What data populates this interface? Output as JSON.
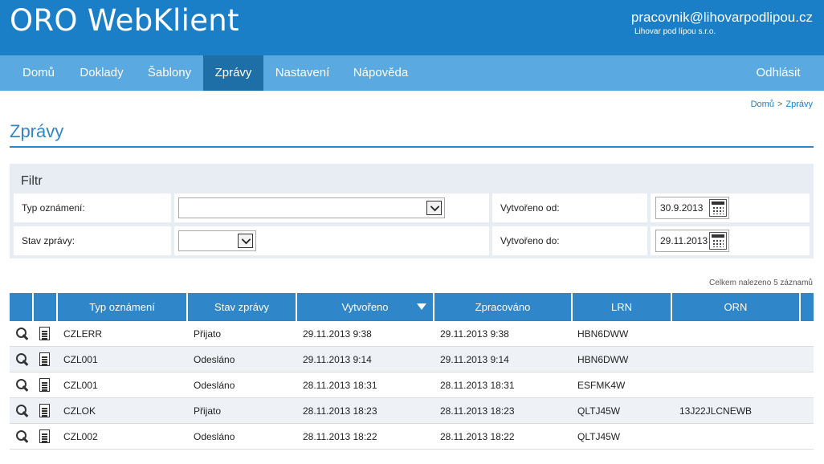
{
  "app": {
    "title": "ORO WebKlient",
    "user_email": "pracovnik@lihovarpodlipou.cz",
    "user_company": "Lihovar pod lípou s.r.o."
  },
  "nav": {
    "items": [
      {
        "label": "Domů"
      },
      {
        "label": "Doklady"
      },
      {
        "label": "Šablony"
      },
      {
        "label": "Zprávy",
        "active": true
      },
      {
        "label": "Nastavení"
      },
      {
        "label": "Nápověda"
      }
    ],
    "logout": "Odhlásit"
  },
  "breadcrumb": {
    "home": "Domů",
    "separator": ">",
    "current": "Zprávy"
  },
  "page": {
    "title": "Zprávy"
  },
  "filter": {
    "title": "Filtr",
    "type_label": "Typ oznámení:",
    "type_value": "",
    "status_label": "Stav zprávy:",
    "status_value": "",
    "created_from_label": "Vytvořeno od:",
    "created_from_value": "30.9.2013",
    "created_to_label": "Vytvořeno do:",
    "created_to_value": "29.11.2013"
  },
  "results": {
    "count_text": "Celkem nalezeno 5 záznamů"
  },
  "table": {
    "columns": {
      "type": "Typ oznámení",
      "status": "Stav zprávy",
      "created": "Vytvořeno",
      "processed": "Zpracováno",
      "lrn": "LRN",
      "orn": "ORN"
    },
    "sorted_column": "created",
    "sort_direction": "desc",
    "rows": [
      {
        "type": "CZLERR",
        "status": "Přijato",
        "created": "29.11.2013 9:38",
        "processed": "29.11.2013 9:38",
        "lrn": "HBN6DWW",
        "orn": ""
      },
      {
        "type": "CZL001",
        "status": "Odesláno",
        "created": "29.11.2013 9:14",
        "processed": "29.11.2013 9:14",
        "lrn": "HBN6DWW",
        "orn": ""
      },
      {
        "type": "CZL001",
        "status": "Odesláno",
        "created": "28.11.2013 18:31",
        "processed": "28.11.2013 18:31",
        "lrn": "ESFMK4W",
        "orn": ""
      },
      {
        "type": "CZLOK",
        "status": "Přijato",
        "created": "28.11.2013 18:23",
        "processed": "28.11.2013 18:23",
        "lrn": "QLTJ45W",
        "orn": "13J22JLCNEWB"
      },
      {
        "type": "CZL002",
        "status": "Odesláno",
        "created": "28.11.2013 18:22",
        "processed": "28.11.2013 18:22",
        "lrn": "QLTJ45W",
        "orn": ""
      }
    ]
  },
  "icons": {
    "detail": "magnifier-icon",
    "document": "document-icon",
    "calendar": "calendar-icon",
    "dropdown": "chevron-down-icon",
    "sort": "sort-desc-icon"
  },
  "colors": {
    "header_bg": "#1b7fc8",
    "nav_bg": "#5aa9e0",
    "nav_active_bg": "#1e6ea8",
    "accent": "#2f86c9",
    "filter_bg": "#e8ecf3",
    "row_alt_bg": "#eef1f6"
  }
}
